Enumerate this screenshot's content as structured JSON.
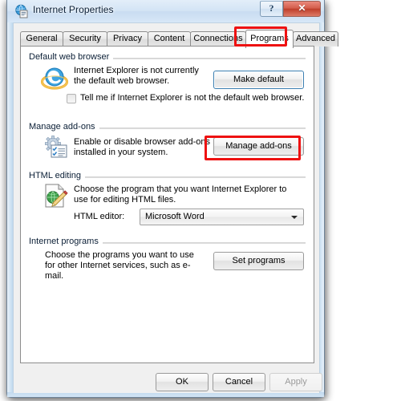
{
  "window": {
    "title": "Internet Properties",
    "icon": "internet-properties-globe-icon",
    "help_button": "?",
    "close_button": "✕"
  },
  "tabs": [
    {
      "label": "General",
      "selected": false
    },
    {
      "label": "Security",
      "selected": false
    },
    {
      "label": "Privacy",
      "selected": false
    },
    {
      "label": "Content",
      "selected": false
    },
    {
      "label": "Connections",
      "selected": false
    },
    {
      "label": "Programs",
      "selected": true
    },
    {
      "label": "Advanced",
      "selected": false
    }
  ],
  "groups": {
    "default_browser": {
      "label": "Default web browser",
      "icon": "internet-explorer-icon",
      "description": "Internet Explorer is not currently the default web browser.",
      "button": "Make default",
      "checkbox": {
        "label": "Tell me if Internet Explorer is not the default web browser.",
        "checked": false
      }
    },
    "manage_addons": {
      "label": "Manage add-ons",
      "icon": "gear-checklist-icon",
      "description": "Enable or disable browser add-ons installed in your system.",
      "button": "Manage add-ons"
    },
    "html_editing": {
      "label": "HTML editing",
      "icon": "page-globe-pencil-icon",
      "description": "Choose the program that you want Internet Explorer to use for editing HTML files.",
      "field_label": "HTML editor:",
      "selected_value": "Microsoft Word",
      "options": [
        "Microsoft Word"
      ]
    },
    "internet_programs": {
      "label": "Internet programs",
      "description": "Choose the programs you want to use for other Internet services, such as e-mail.",
      "button": "Set programs"
    }
  },
  "footer": {
    "ok": "OK",
    "cancel": "Cancel",
    "apply": "Apply",
    "apply_disabled": true
  },
  "annotations": [
    {
      "name": "programs-tab-highlight",
      "color": "#ee1111"
    },
    {
      "name": "manage-addons-button-highlight",
      "color": "#ee1111"
    }
  ],
  "colors": {
    "annotation_red": "#ee1111",
    "dialog_face": "#f0f0f0",
    "panel_white": "#ffffff",
    "titlebar_blue": "#d3e4f5",
    "close_red": "#bf3f2b",
    "focus_blue": "#3c7fb1"
  }
}
